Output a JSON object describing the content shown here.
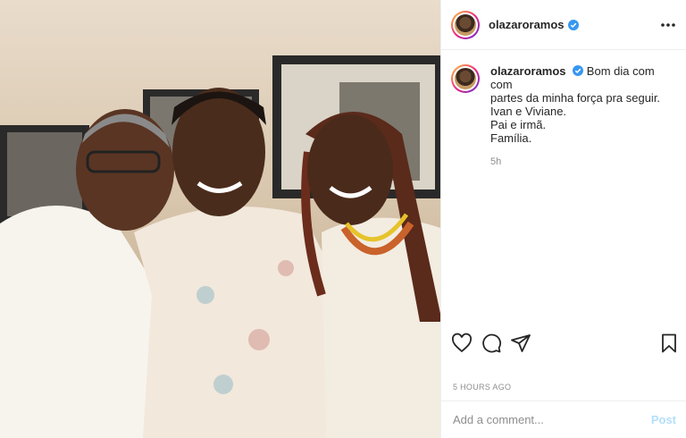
{
  "post": {
    "username": "olazaroramos",
    "verified": true,
    "caption_lines": [
      "Bom dia com com",
      "partes da minha força pra seguir.",
      "Ivan e Viviane.",
      "Pai e irmã.",
      "Família."
    ],
    "time_ago": "5h",
    "posted_label": "5 HOURS AGO"
  },
  "icons": {
    "more": "more-icon",
    "like": "heart-icon",
    "comment": "comment-icon",
    "share": "share-icon",
    "save": "bookmark-icon",
    "verified": "verified-icon"
  },
  "comment_box": {
    "placeholder": "Add a comment...",
    "post_label": "Post"
  },
  "colors": {
    "verified": "#3897f0",
    "post_disabled": "#b2dffc",
    "muted": "#8e8e8e",
    "text": "#262626"
  }
}
